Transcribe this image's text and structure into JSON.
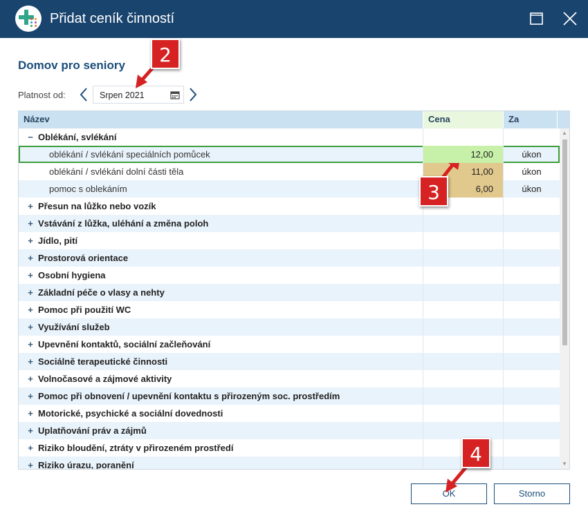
{
  "window": {
    "title": "Přidat ceník činností",
    "maximize_icon": "maximize-icon",
    "close_icon": "close-icon"
  },
  "page": {
    "heading": "Domov pro seniory",
    "validity_label": "Platnost od:",
    "date_value": "Srpen 2021"
  },
  "grid": {
    "columns": [
      "Název",
      "Cena",
      "Za"
    ],
    "rows": [
      {
        "type": "group",
        "toggle": "−",
        "name": "Oblékání, svlékání",
        "price": "",
        "unit": ""
      },
      {
        "type": "item",
        "name": "oblékání / svlékání speciálních pomůcek",
        "price": "12,00",
        "unit": "úkon",
        "selected": true,
        "price_color": "green"
      },
      {
        "type": "item",
        "name": "oblékání / svlékání dolní části těla",
        "price": "11,00",
        "unit": "úkon",
        "price_color": "tan"
      },
      {
        "type": "item",
        "name": "pomoc s oblekáním",
        "price": "6,00",
        "unit": "úkon",
        "price_color": "tan"
      },
      {
        "type": "group",
        "toggle": "+",
        "name": "Přesun na lůžko nebo vozík"
      },
      {
        "type": "group",
        "toggle": "+",
        "name": "Vstávání z lůžka, uléhání a změna poloh"
      },
      {
        "type": "group",
        "toggle": "+",
        "name": "Jídlo, pití"
      },
      {
        "type": "group",
        "toggle": "+",
        "name": "Prostorová orientace"
      },
      {
        "type": "group",
        "toggle": "+",
        "name": "Osobní hygiena"
      },
      {
        "type": "group",
        "toggle": "+",
        "name": "Základní péče o vlasy a nehty"
      },
      {
        "type": "group",
        "toggle": "+",
        "name": "Pomoc při použití WC"
      },
      {
        "type": "group",
        "toggle": "+",
        "name": "Využívání služeb"
      },
      {
        "type": "group",
        "toggle": "+",
        "name": "Upevnění kontaktů, sociální začleňování"
      },
      {
        "type": "group",
        "toggle": "+",
        "name": "Sociálně terapeutické činnosti"
      },
      {
        "type": "group",
        "toggle": "+",
        "name": "Volnočasové a zájmové aktivity"
      },
      {
        "type": "group",
        "toggle": "+",
        "name": "Pomoc při obnovení / upevnění kontaktu s přirozeným soc. prostředím"
      },
      {
        "type": "group",
        "toggle": "+",
        "name": "Motorické, psychické a sociální dovednosti"
      },
      {
        "type": "group",
        "toggle": "+",
        "name": "Uplatňování práv a zájmů"
      },
      {
        "type": "group",
        "toggle": "+",
        "name": "Riziko bloudění, ztráty v přirozeném prostředí"
      },
      {
        "type": "group",
        "toggle": "+",
        "name": "Riziko úrazu, poranění"
      }
    ]
  },
  "buttons": {
    "ok": "OK",
    "cancel": "Storno"
  },
  "callouts": [
    "2",
    "3",
    "4"
  ],
  "colors": {
    "titlebar": "#19446e",
    "accent": "#1a4d7a",
    "header_bg": "#c9e1f1",
    "selected_price": "#c7f0a8",
    "other_price": "#e1c88c",
    "callout": "#d62222"
  }
}
